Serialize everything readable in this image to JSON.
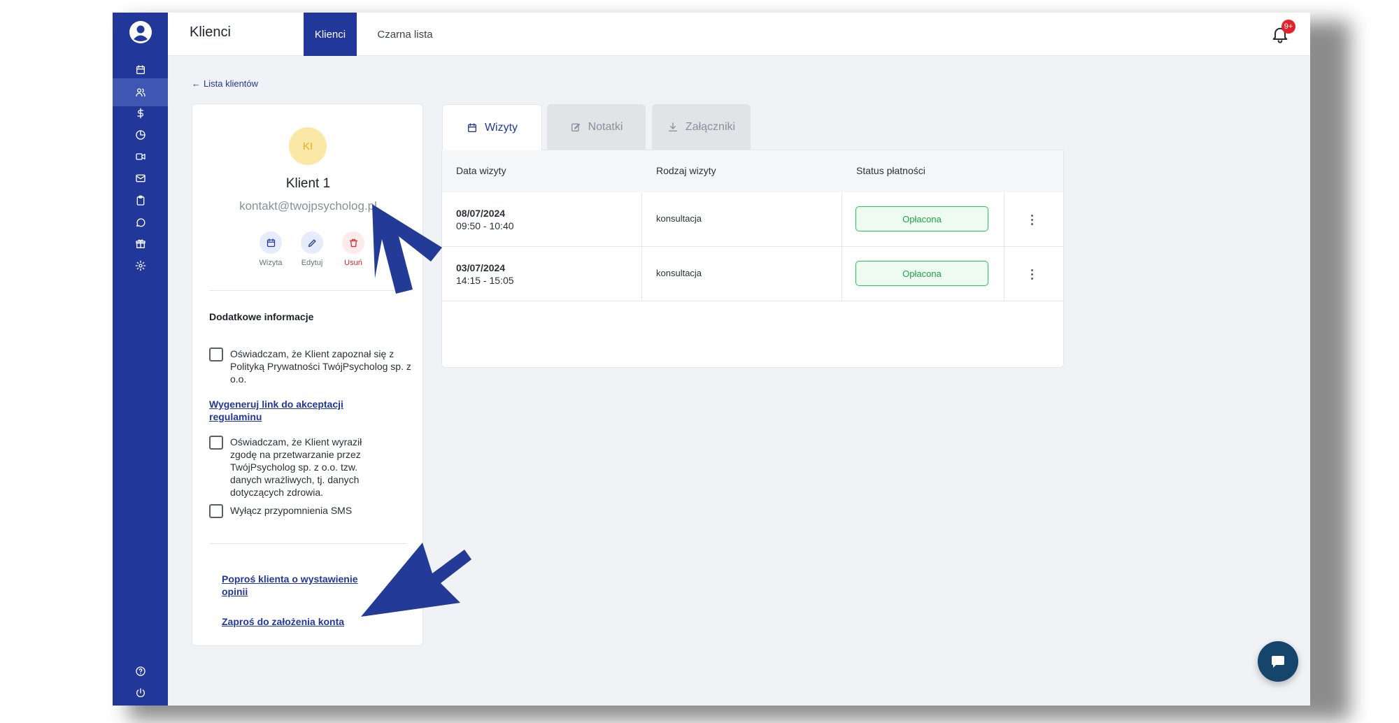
{
  "header": {
    "title": "Klienci",
    "tabs": [
      {
        "label": "Klienci",
        "active": true
      },
      {
        "label": "Czarna lista",
        "active": false
      }
    ],
    "notification_badge": "9+"
  },
  "sidebar": {
    "items": [
      {
        "icon": "calendar-icon"
      },
      {
        "icon": "users-icon",
        "active": true
      },
      {
        "icon": "dollar-icon"
      },
      {
        "icon": "pie-chart-icon"
      },
      {
        "icon": "video-icon"
      },
      {
        "icon": "mail-icon"
      },
      {
        "icon": "clipboard-icon"
      },
      {
        "icon": "chat-icon"
      },
      {
        "icon": "gift-icon"
      },
      {
        "icon": "settings-icon"
      },
      {
        "icon": "help-icon"
      },
      {
        "icon": "power-icon"
      }
    ]
  },
  "back_link": "Lista klientów",
  "client": {
    "initials": "KI",
    "name": "Klient 1",
    "email": "kontakt@twojpsycholog.pl",
    "actions": {
      "visit": "Wizyta",
      "edit": "Edytuj",
      "delete": "Usuń"
    }
  },
  "additional_info": {
    "heading": "Dodatkowe informacje",
    "privacy_consent": "Oświadczam, że Klient zapoznał się z Polityką Prywatności TwójPsycholog sp. z o.o.",
    "generate_link": "Wygeneruj link do akceptacji regulaminu",
    "data_consent": "Oświadczam, że Klient wyraził zgodę na przetwarzanie przez TwójPsycholog sp. z o.o. tzw. danych wrażliwych, tj. danych dotyczących zdrowia.",
    "sms_off": "Wyłącz przypomnienia SMS",
    "request_review": "Poproś klienta o wystawienie opinii",
    "invite_account": "Zaproś do założenia konta"
  },
  "visits": {
    "tabs": {
      "visits": "Wizyty",
      "notes": "Notatki",
      "attachments": "Załączniki"
    },
    "columns": {
      "date": "Data wizyty",
      "type": "Rodzaj wizyty",
      "status": "Status płatności"
    },
    "rows": [
      {
        "date": "08/07/2024",
        "time": "09:50 - 10:40",
        "type": "konsultacja",
        "status": "Opłacona"
      },
      {
        "date": "03/07/2024",
        "time": "14:15 - 15:05",
        "type": "konsultacja",
        "status": "Opłacona"
      }
    ]
  },
  "colors": {
    "primary": "#21389a",
    "status_paid": "#2bc35b",
    "badge": "#e0242c",
    "annotation_arrow": "#233a96"
  }
}
